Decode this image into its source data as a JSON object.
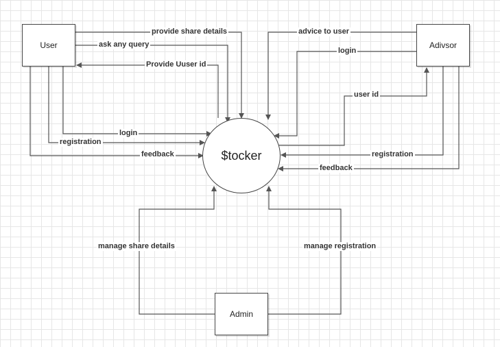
{
  "nodes": {
    "user": "User",
    "advisor": "Adivsor",
    "admin": "Admin",
    "system": "$tocker"
  },
  "flows": {
    "provide_share_details": "provide share details",
    "ask_any_query": "ask any query",
    "provide_user_id": "Provide Uuser id",
    "user_login": "login",
    "user_registration": "registration",
    "user_feedback": "feedback",
    "advice_to_user": "advice to user",
    "advisor_login": "login",
    "user_id": "user id",
    "advisor_registration": "registration",
    "advisor_feedback": "feedback",
    "manage_share_details": "manage share details",
    "manage_registration": "manage registration"
  }
}
